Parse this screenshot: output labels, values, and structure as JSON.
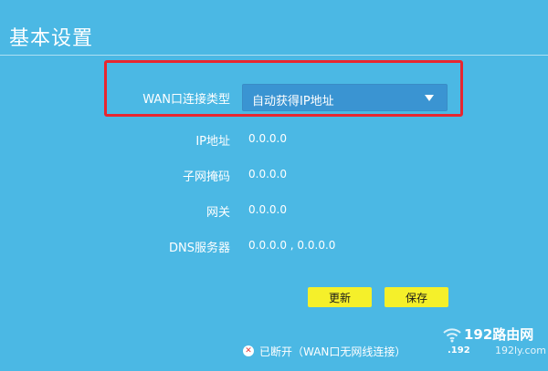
{
  "header": {
    "title": "基本设置"
  },
  "form": {
    "wan_type": {
      "label": "WAN口连接类型",
      "selected": "自动获得IP地址"
    },
    "ip": {
      "label": "IP地址",
      "value": "0.0.0.0"
    },
    "mask": {
      "label": "子网掩码",
      "value": "0.0.0.0"
    },
    "gateway": {
      "label": "网关",
      "value": "0.0.0.0"
    },
    "dns": {
      "label": "DNS服务器",
      "value": "0.0.0.0 , 0.0.0.0"
    }
  },
  "actions": {
    "refresh_label": "更新",
    "save_label": "保存"
  },
  "status": {
    "text": "已断开（WAN口无网线连接）",
    "icon": "error-x-icon"
  },
  "watermark": {
    "brand": "192路由网",
    "domain": "192ly.com",
    "fragment": ".192"
  },
  "colors": {
    "background": "#4bb8e4",
    "highlight": "#e8262f",
    "button": "#f5f02a",
    "select": "#3a94d2"
  }
}
